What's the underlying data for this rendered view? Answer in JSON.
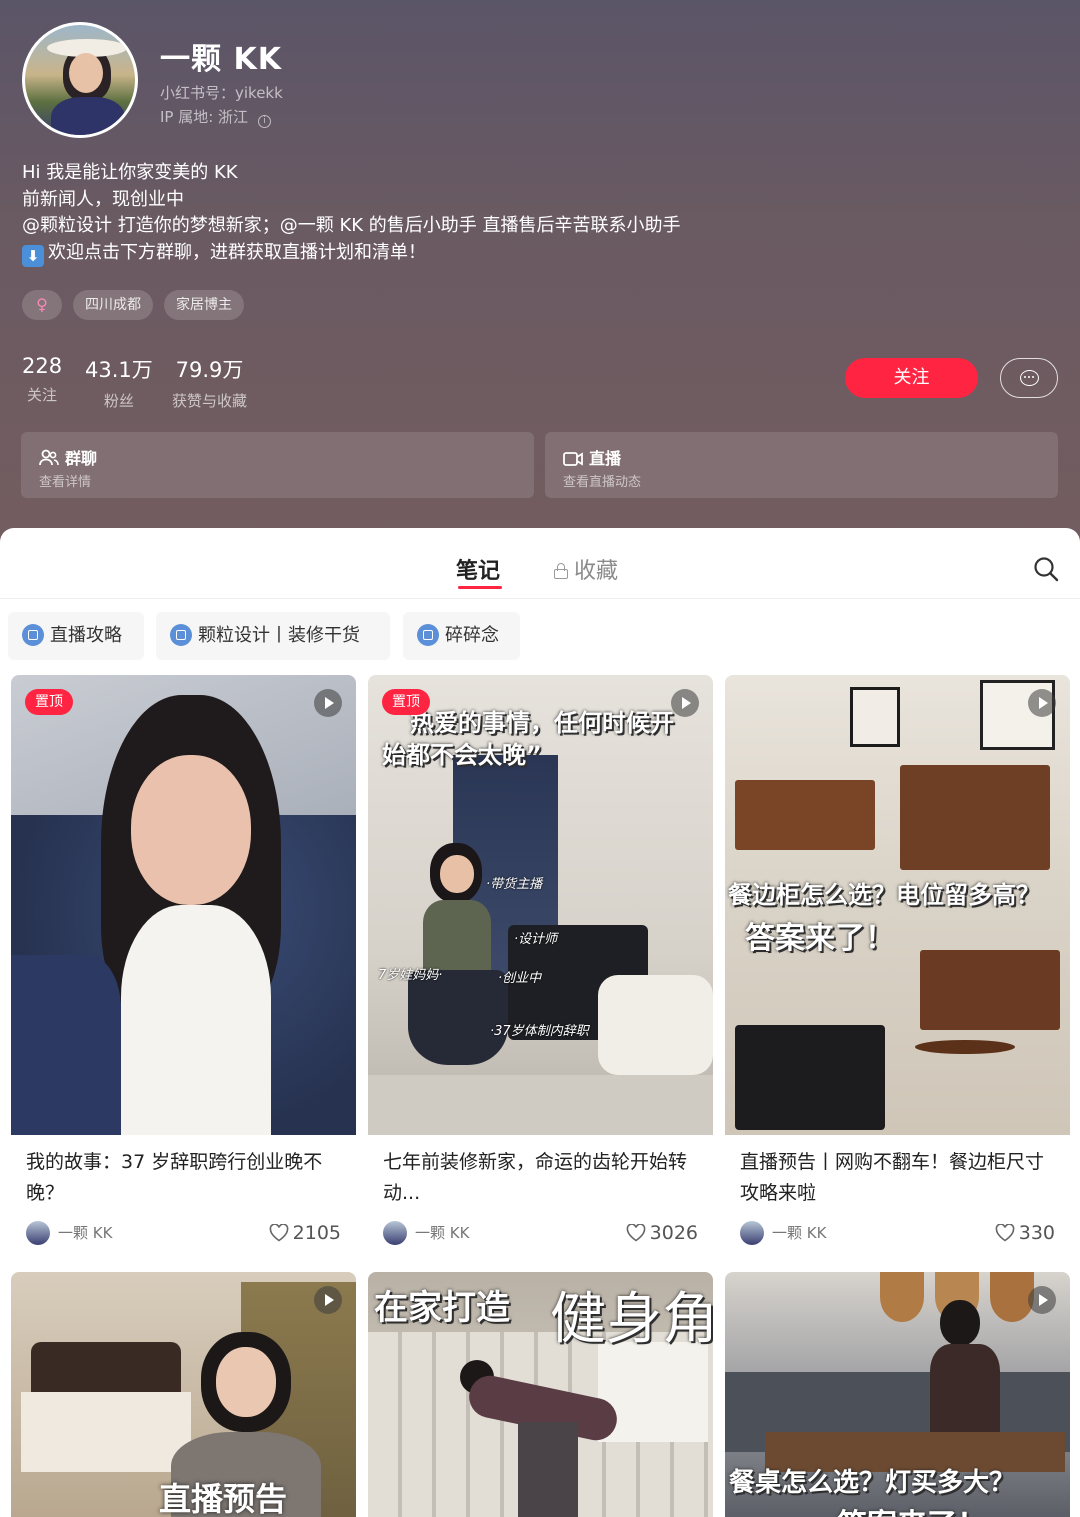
{
  "profile": {
    "name": "一颗 KK",
    "account": "小红书号：yikekk",
    "ip": "IP 属地: 浙江",
    "bio": [
      "Hi 我是能让你家变美的 KK",
      "前新闻人，现创业中",
      "@颗粒设计 打造你的梦想新家；@一颗 KK 的售后小助手 直播售后辛苦联系小助手",
      "欢迎点击下方群聊，进群获取直播计划和清单！"
    ],
    "bio_arrow": "⬇",
    "tags": {
      "gender": "♀",
      "location": "四川成都",
      "role": "家居博主"
    },
    "stats": [
      {
        "value": "228",
        "label": "关注"
      },
      {
        "value": "43.1万",
        "label": "粉丝"
      },
      {
        "value": "79.9万",
        "label": "获赞与收藏"
      }
    ],
    "follow_label": "关注",
    "message_icon": "chat-bubble-icon"
  },
  "cards": {
    "group": {
      "title": "群聊",
      "desc": "查看详情",
      "icon": "group-icon"
    },
    "live": {
      "title": "直播",
      "desc": "查看直播动态",
      "icon": "live-icon"
    }
  },
  "tabs": {
    "notes": "笔记",
    "favorites": "收藏"
  },
  "collections": [
    "直播攻略",
    "颗粒设计丨装修干货",
    "碎碎念"
  ],
  "notes": [
    {
      "pinned": "置顶",
      "title": "我的故事：37 岁辞职跨行创业晚不晚？",
      "author": "一颗 KK",
      "likes": "2105"
    },
    {
      "pinned": "置顶",
      "title": "七年前装修新家，命运的齿轮开始转动...",
      "author": "一颗 KK",
      "likes": "3026",
      "overlay": [
        "热爱的事情，任何时候开",
        "始都不会太晚”"
      ],
      "captions": [
        "·带货主播",
        "·设计师",
        "7岁娃妈妈·",
        "·创业中",
        "·37岁体制内辞职"
      ]
    },
    {
      "title": "直播预告丨网购不翻车！餐边柜尺寸攻略来啦",
      "author": "一颗 KK",
      "likes": "330",
      "overlay": [
        "餐边柜怎么选？电位留多高？",
        "答案来了！"
      ]
    },
    {
      "overlay": [
        "直播预告"
      ]
    },
    {
      "overlay": [
        "在家打造",
        "健身角"
      ]
    },
    {
      "overlay": [
        "餐桌怎么选？灯买多大？",
        "答案来了！"
      ]
    }
  ],
  "colors": {
    "accent": "#ff2442",
    "header_bg": "#6a5a62",
    "collection_icon": "#5b8fd7"
  }
}
